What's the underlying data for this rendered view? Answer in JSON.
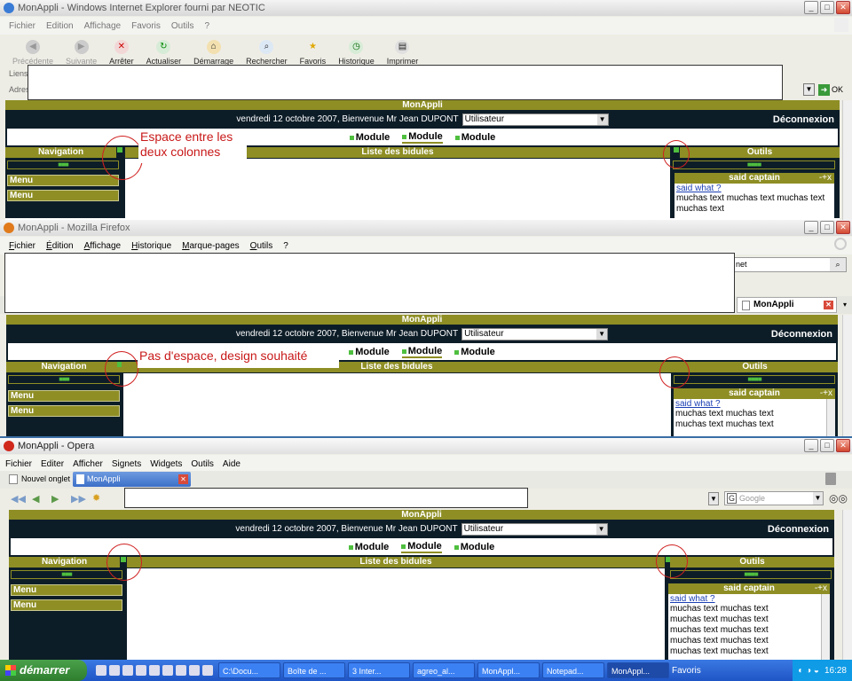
{
  "ie": {
    "title": "MonAppli - Windows Internet Explorer fourni par NEOTIC",
    "menu": [
      "Fichier",
      "Edition",
      "Affichage",
      "Favoris",
      "Outils",
      "?"
    ],
    "toolbar": [
      "Précédente",
      "Suivante",
      "Arrêter",
      "Actualiser",
      "Démarrage",
      "Rechercher",
      "Favoris",
      "Historique",
      "Imprimer"
    ],
    "links_label": "Liens",
    "address_label": "Adres",
    "go_label": "OK",
    "annotation": "Espace entre les\ndeux colonnes"
  },
  "firefox": {
    "title": "MonAppli - Mozilla Firefox",
    "menu": [
      "Fichier",
      "Édition",
      "Affichage",
      "Historique",
      "Marque-pages",
      "Outils",
      "?"
    ],
    "search_value": "net",
    "tab_label": "MonAppli",
    "annotation": "Pas d'espace, design souhaité"
  },
  "opera": {
    "title": "MonAppli - Opera",
    "menu": [
      "Fichier",
      "Editer",
      "Afficher",
      "Signets",
      "Widgets",
      "Outils",
      "Aide"
    ],
    "new_tab_label": "Nouvel onglet",
    "tab_label": "MonAppli",
    "search_placeholder": "Google"
  },
  "app": {
    "header": "MonAppli",
    "welcome": "vendredi 12 octobre 2007, Bienvenue Mr Jean DUPONT",
    "role_select": "Utilisateur",
    "logout": "Déconnexion",
    "modules": [
      "Module",
      "Module",
      "Module"
    ],
    "navigation": "Navigation",
    "list_title": "Liste des bidules",
    "tools": "Outils",
    "menu_items": [
      "Menu",
      "Menu"
    ],
    "box_title": "said captain",
    "box_controls": "-+x",
    "box_link": "said what ?",
    "box_text": "muchas text muchas text",
    "box_text_ie": "muchas text muchas text muchas text muchas text"
  },
  "taskbar": {
    "start": "démarrer",
    "tasks": [
      "C:\\Docu...",
      "Boîte de ...",
      "3 Inter...",
      "agreo_al...",
      "MonAppl...",
      "Notepad...",
      "MonAppl..."
    ],
    "favorites": "Favoris",
    "clock": "16:28"
  }
}
